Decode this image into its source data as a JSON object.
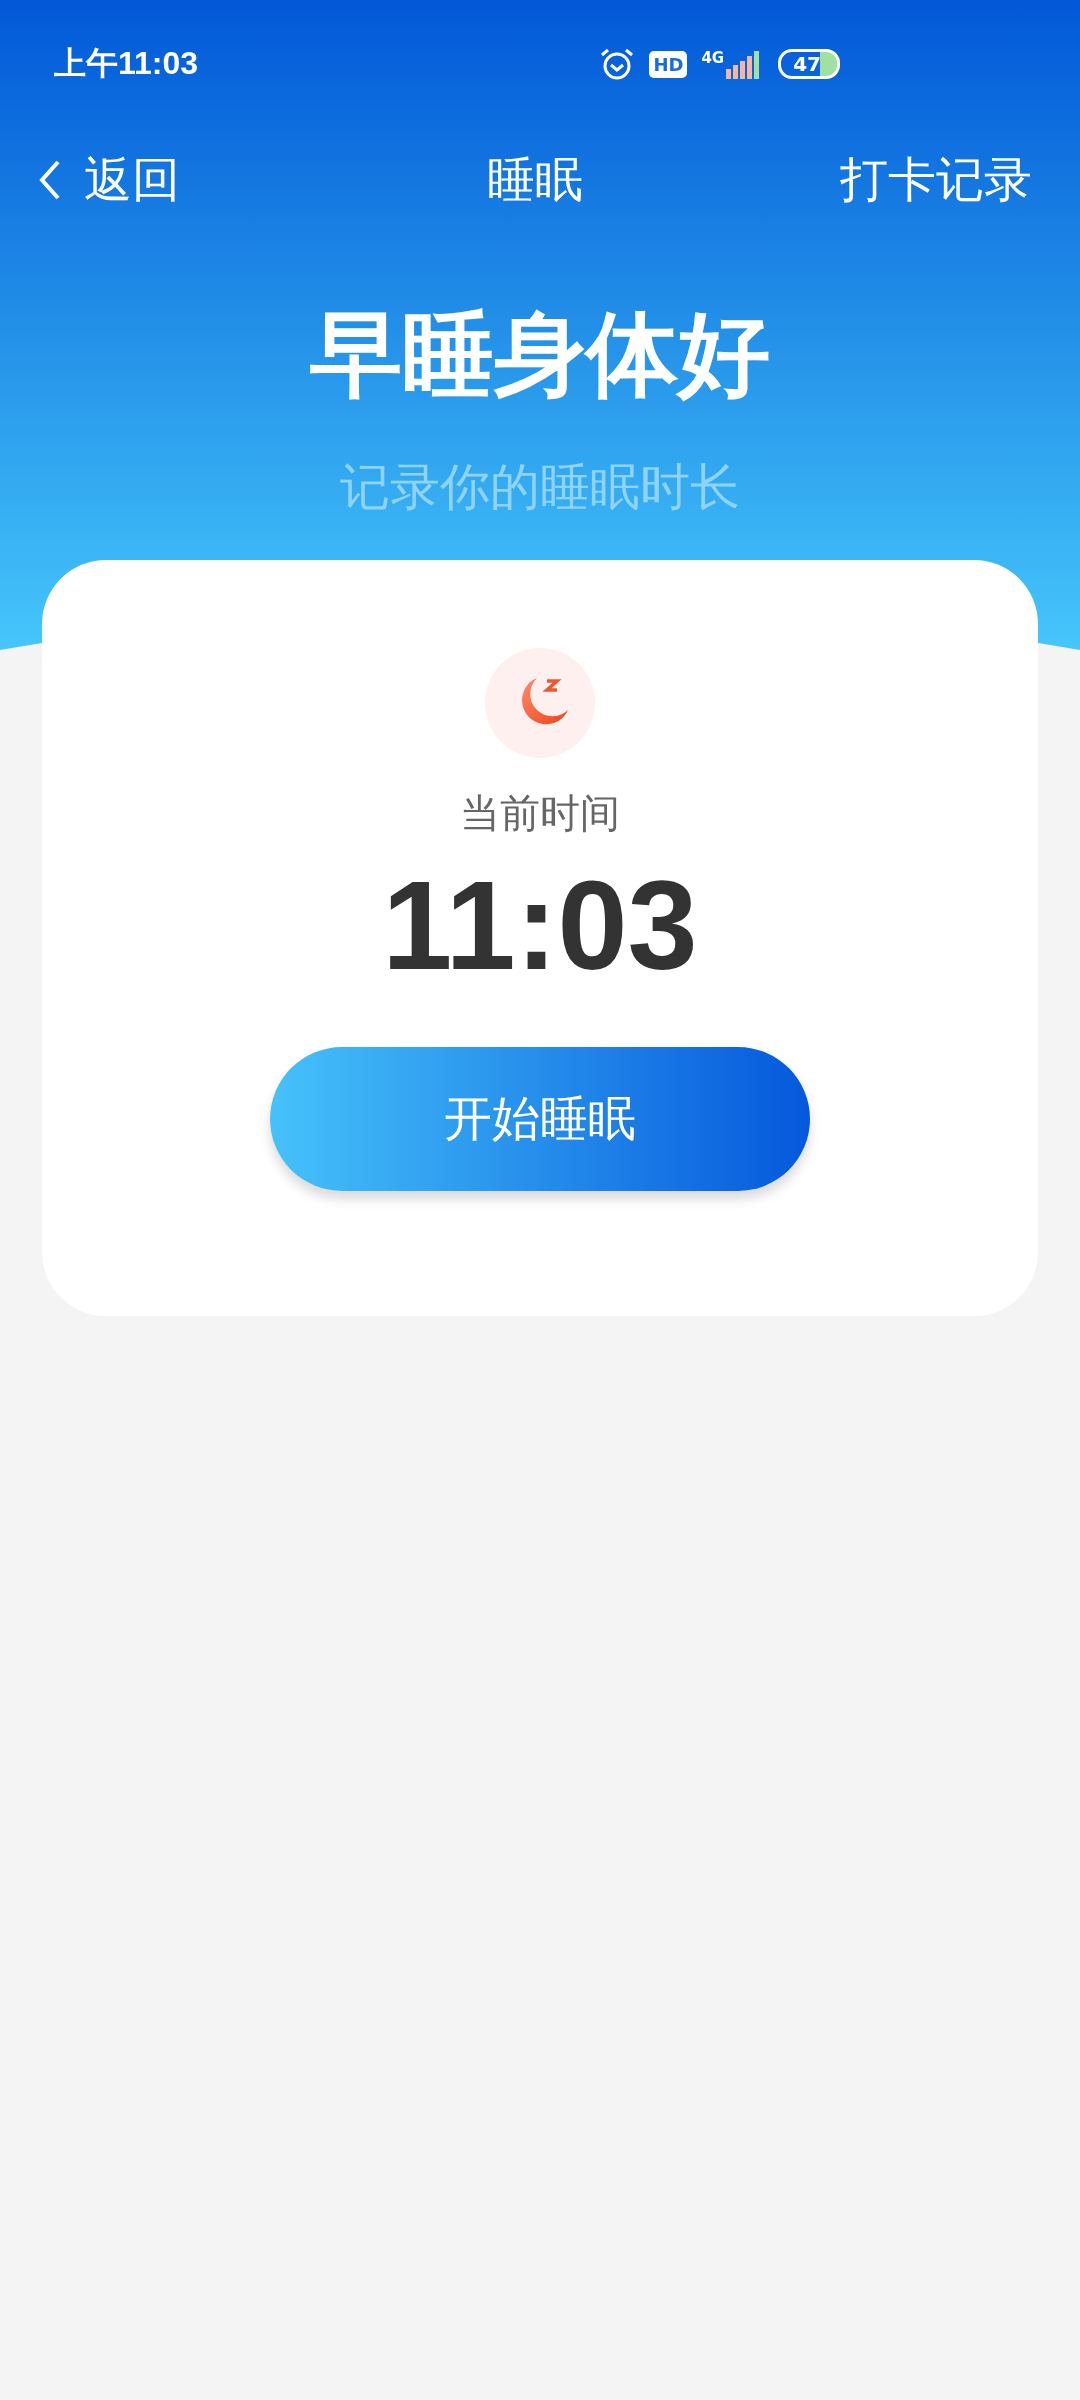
{
  "status_bar": {
    "time": "上午11:03",
    "hd": "HD",
    "network": "4G",
    "battery": "47"
  },
  "nav": {
    "back": "返回",
    "title": "睡眠",
    "action": "打卡记录"
  },
  "hero": {
    "title": "早睡身体好",
    "subtitle": "记录你的睡眠时长"
  },
  "card": {
    "label": "当前时间",
    "time": "11:03",
    "button": "开始睡眠"
  }
}
